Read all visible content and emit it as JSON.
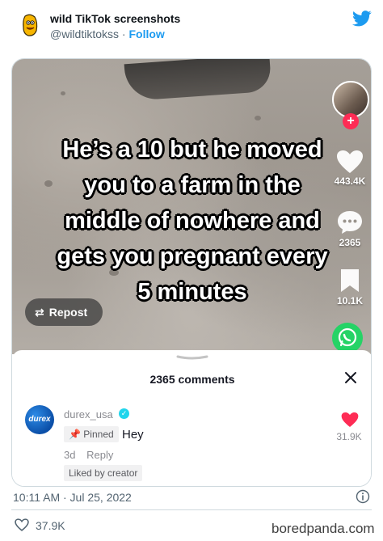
{
  "tweet": {
    "author_name": "wild TikTok screenshots",
    "handle": "@wildtiktokss",
    "separator": "·",
    "follow_label": "Follow",
    "timestamp": "10:11 AM · Jul 25, 2022",
    "likes": "37.9K"
  },
  "video": {
    "caption_lines": [
      "He’s a 10 but he moved",
      "you to a farm in the",
      "middle of nowhere and",
      "gets you pregnant every",
      "5 minutes"
    ],
    "repost_label": "Repost",
    "like_count": "443.4K",
    "comment_count": "2365",
    "save_count": "10.1K"
  },
  "comments": {
    "header": "2365 comments",
    "item": {
      "username": "durex_usa",
      "logo_text": "durex",
      "pinned_label": "Pinned",
      "text": "Hey",
      "age": "3d",
      "reply_label": "Reply",
      "liked_label": "Liked by creator",
      "like_count": "31.9K"
    }
  },
  "watermark": "boredpanda.com",
  "colors": {
    "twitter_blue": "#1d9bf0",
    "tiktok_red": "#fe2c55",
    "whatsapp_green": "#25d366",
    "verified_cyan": "#20d5ec"
  }
}
